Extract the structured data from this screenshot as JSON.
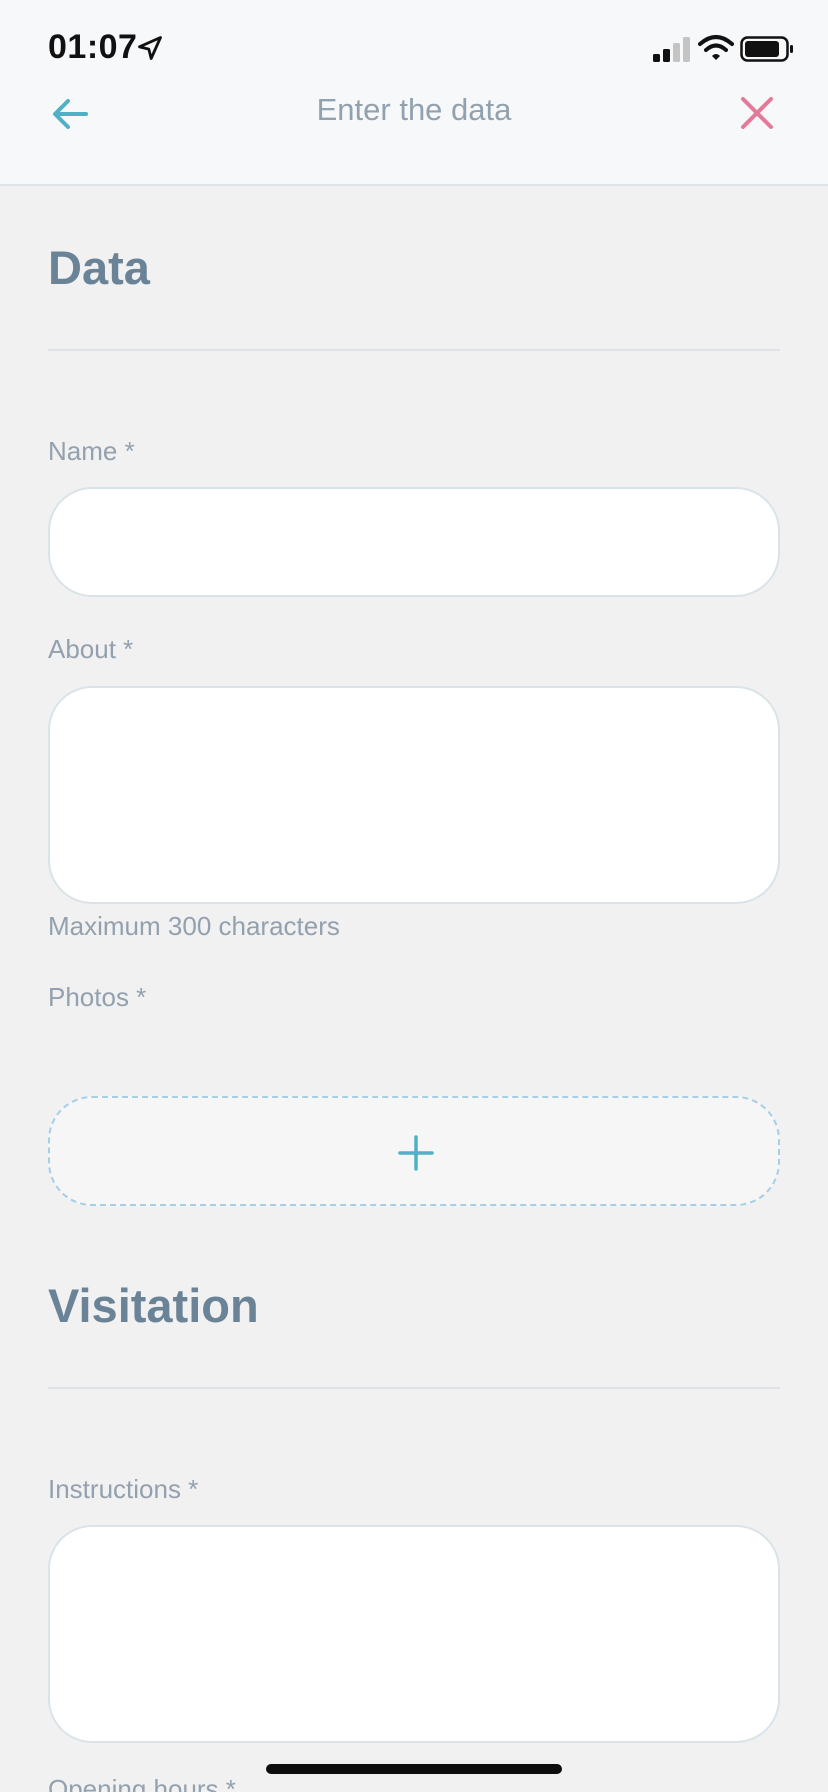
{
  "status_bar": {
    "time": "01:07"
  },
  "nav": {
    "title": "Enter the data"
  },
  "sections": {
    "data": {
      "title": "Data",
      "name_label": "Name *",
      "name_value": "",
      "about_label": "About *",
      "about_value": "",
      "about_hint": "Maximum 300 characters",
      "photos_label": "Photos *"
    },
    "visitation": {
      "title": "Visitation",
      "instructions_label": "Instructions *",
      "instructions_value": "",
      "opening_hours_label": "Opening hours *"
    }
  },
  "colors": {
    "accent": "#4fb0c6",
    "close": "#e5799a",
    "section_title": "#6a8397",
    "label": "#93a1ae"
  },
  "icons": {
    "back": "arrow-left-icon",
    "close": "close-icon",
    "add_photo": "plus-icon"
  }
}
